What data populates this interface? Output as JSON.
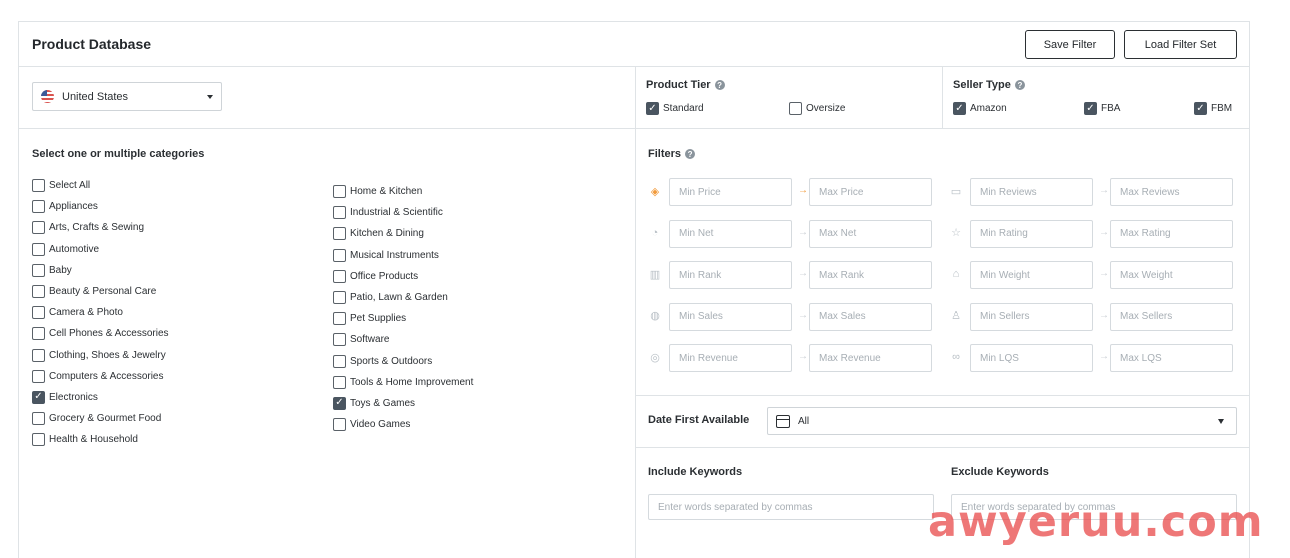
{
  "header": {
    "title": "Product Database",
    "save_filter": "Save Filter",
    "load_filter_set": "Load Filter Set"
  },
  "country": {
    "selected": "United States",
    "icon": "us-flag-icon"
  },
  "categories": {
    "title": "Select one or multiple categories",
    "col1": [
      {
        "label": "Select All",
        "checked": false
      },
      {
        "label": "Appliances",
        "checked": false
      },
      {
        "label": "Arts, Crafts & Sewing",
        "checked": false
      },
      {
        "label": "Automotive",
        "checked": false
      },
      {
        "label": "Baby",
        "checked": false
      },
      {
        "label": "Beauty & Personal Care",
        "checked": false
      },
      {
        "label": "Camera & Photo",
        "checked": false
      },
      {
        "label": "Cell Phones & Accessories",
        "checked": false
      },
      {
        "label": "Clothing, Shoes & Jewelry",
        "checked": false
      },
      {
        "label": "Computers & Accessories",
        "checked": false
      },
      {
        "label": "Electronics",
        "checked": true
      },
      {
        "label": "Grocery & Gourmet Food",
        "checked": false
      },
      {
        "label": "Health & Household",
        "checked": false
      }
    ],
    "col2": [
      {
        "label": "Home & Kitchen",
        "checked": false
      },
      {
        "label": "Industrial & Scientific",
        "checked": false
      },
      {
        "label": "Kitchen & Dining",
        "checked": false
      },
      {
        "label": "Musical Instruments",
        "checked": false
      },
      {
        "label": "Office Products",
        "checked": false
      },
      {
        "label": "Patio, Lawn & Garden",
        "checked": false
      },
      {
        "label": "Pet Supplies",
        "checked": false
      },
      {
        "label": "Software",
        "checked": false
      },
      {
        "label": "Sports & Outdoors",
        "checked": false
      },
      {
        "label": "Tools & Home Improvement",
        "checked": false
      },
      {
        "label": "Toys & Games",
        "checked": true
      },
      {
        "label": "Video Games",
        "checked": false
      }
    ]
  },
  "product_tier": {
    "label": "Product Tier",
    "options": [
      {
        "label": "Standard",
        "checked": true
      },
      {
        "label": "Oversize",
        "checked": false
      }
    ]
  },
  "seller_type": {
    "label": "Seller Type",
    "options": [
      {
        "label": "Amazon",
        "checked": true
      },
      {
        "label": "FBA",
        "checked": true
      },
      {
        "label": "FBM",
        "checked": true
      }
    ]
  },
  "filters": {
    "title": "Filters",
    "left": [
      {
        "icon": "price-tag-icon",
        "min": "Min Price",
        "max": "Max Price",
        "accent": true
      },
      {
        "icon": "money-bag-icon",
        "min": "Min Net",
        "max": "Max Net",
        "accent": false
      },
      {
        "icon": "rank-bars-icon",
        "min": "Min Rank",
        "max": "Max Rank",
        "accent": false
      },
      {
        "icon": "sales-jar-icon",
        "min": "Min Sales",
        "max": "Max Sales",
        "accent": false
      },
      {
        "icon": "revenue-coin-icon",
        "min": "Min Revenue",
        "max": "Max Revenue",
        "accent": false
      }
    ],
    "right": [
      {
        "icon": "reviews-bubble-icon",
        "min": "Min Reviews",
        "max": "Max Reviews"
      },
      {
        "icon": "star-icon",
        "min": "Min Rating",
        "max": "Max Rating"
      },
      {
        "icon": "weight-icon",
        "min": "Min Weight",
        "max": "Max Weight"
      },
      {
        "icon": "sellers-people-icon",
        "min": "Min Sellers",
        "max": "Max Sellers"
      },
      {
        "icon": "lqs-icon",
        "min": "Min LQS",
        "max": "Max LQS"
      }
    ]
  },
  "date_first_available": {
    "label": "Date First Available",
    "value": "All"
  },
  "keywords": {
    "include_label": "Include Keywords",
    "include_placeholder": "Enter words separated by commas",
    "exclude_label": "Exclude Keywords",
    "exclude_placeholder": "Enter words separated by commas"
  },
  "watermark": "awyeruu.com",
  "colors": {
    "accent": "#f29a3a",
    "checkbox_on": "#4a5560",
    "border": "#dfe3e6",
    "watermark": "#e94a4a"
  }
}
